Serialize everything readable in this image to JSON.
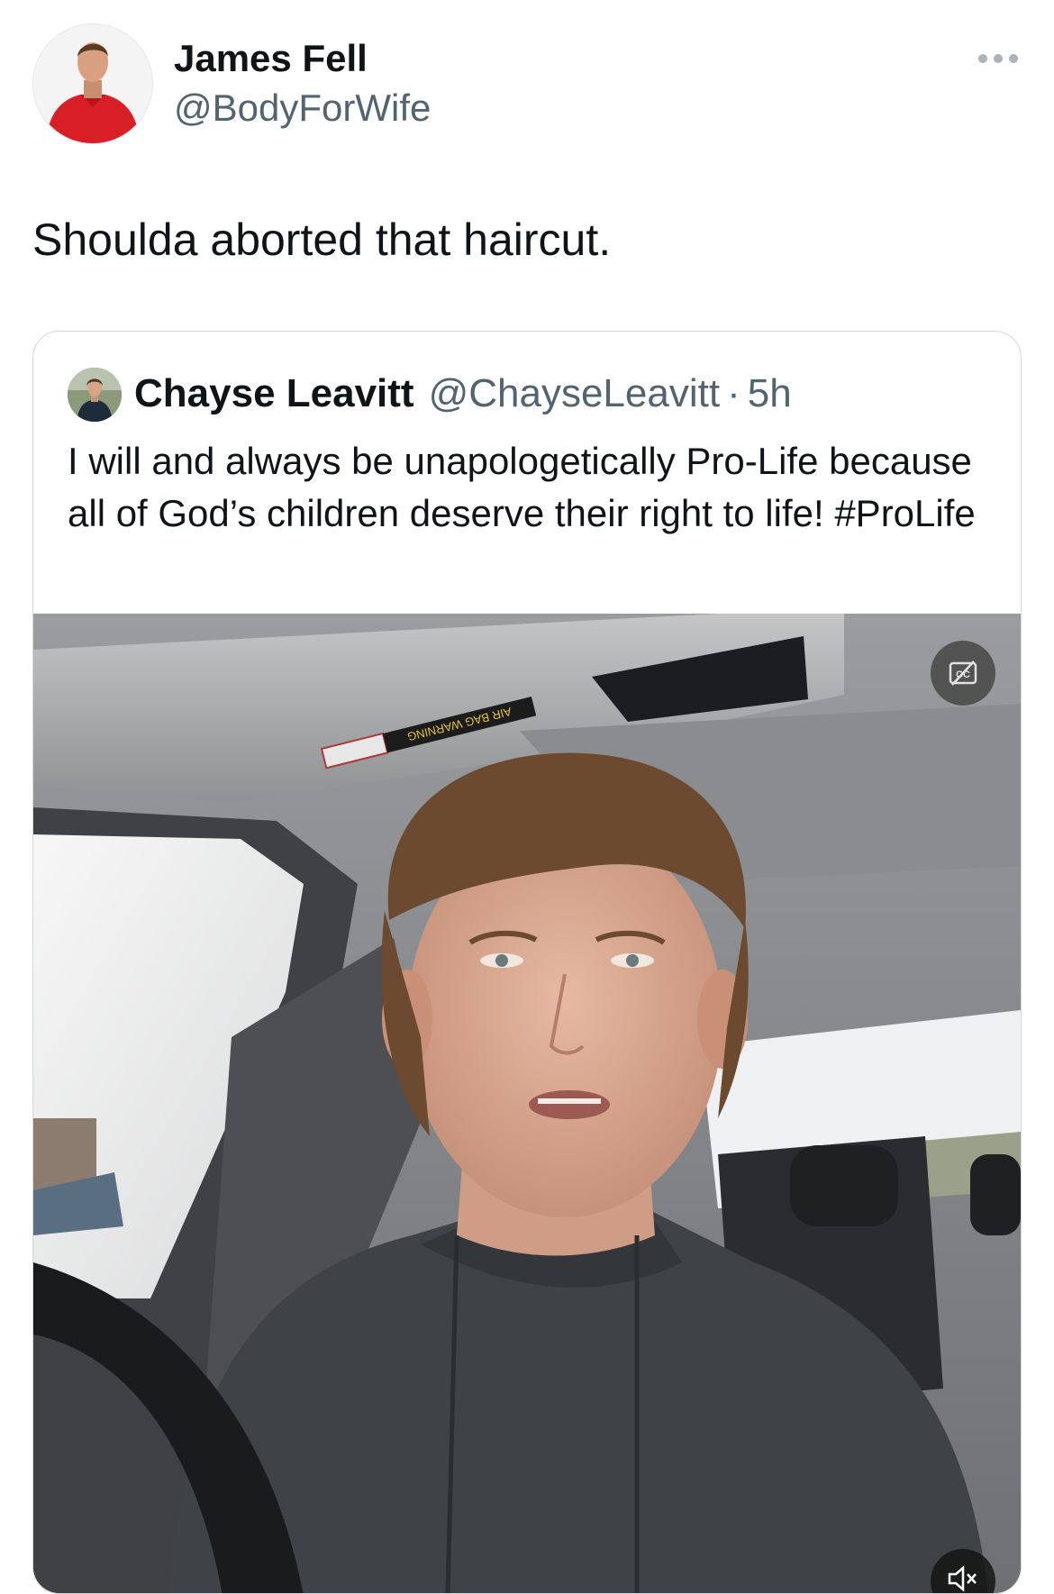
{
  "tweet": {
    "author_name": "James Fell",
    "author_handle": "@BodyForWife",
    "text": "Shoulda aborted that haircut.",
    "more_icon": "ellipsis-icon"
  },
  "quote": {
    "author_name": "Chayse Leavitt",
    "author_handle": "@ChayseLeavitt",
    "separator": "·",
    "time": "5h",
    "text": "I will and always be unapologetically Pro-Life because all of God’s children deserve their right to life!",
    "hashtag": "#ProLife",
    "media": {
      "type": "video",
      "cc_icon": "captions-off-icon",
      "mute_icon": "speaker-muted-icon",
      "visor_label": "AIR BAG WARNING"
    }
  },
  "colors": {
    "primary_text": "#0f1419",
    "secondary_text": "#536471",
    "border": "#cfd9de"
  }
}
